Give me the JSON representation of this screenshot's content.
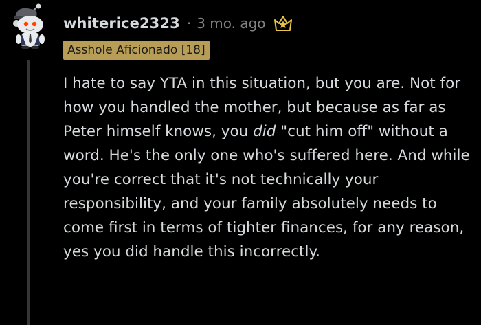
{
  "comment": {
    "author": "whiterice2323",
    "separator": "·",
    "timestamp": "3 mo. ago",
    "flair": "Asshole Aficionado [18]",
    "body": {
      "part1": "I hate to say YTA in this situation, but you are. Not for how you handled the mother, but because as far as Peter himself knows, you ",
      "emphasis": "did",
      "part2": " \"cut him off\" without a word. He's the only one who's suffered here. And while you're correct that it's not technically your responsibility, and your family absolutely needs to come first in terms of tighter finances, for any reason, yes you did handle this incorrectly."
    }
  },
  "icons": {
    "avatar": "snoo-avatar",
    "award": "crown-star-award-icon"
  },
  "colors": {
    "background": "#000000",
    "text": "#d7dadc",
    "meta": "#818384",
    "flair_bg": "#b79d55",
    "thread_line": "#343536",
    "award": "#e8c547"
  }
}
